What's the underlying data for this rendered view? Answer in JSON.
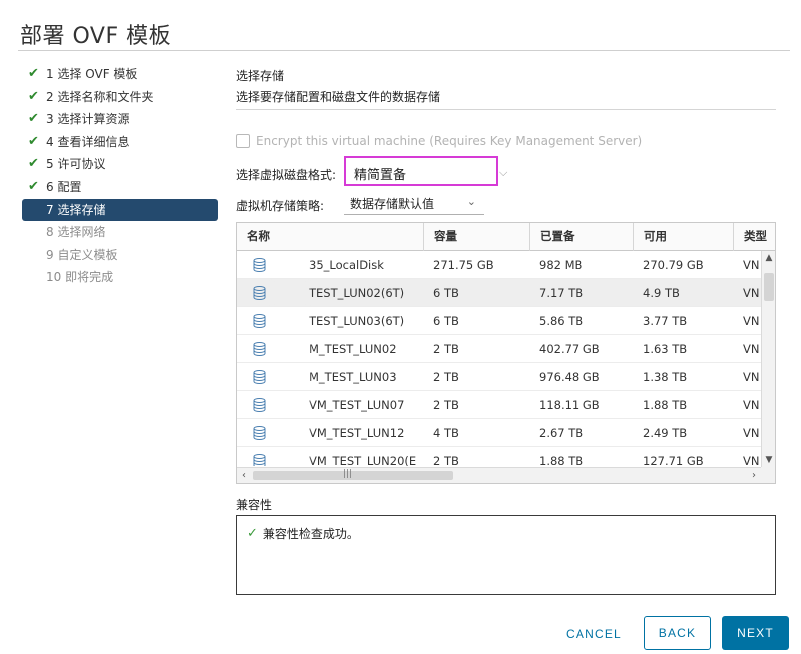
{
  "dialog": {
    "title": "部署 OVF 模板"
  },
  "steps": [
    {
      "label": "1 选择 OVF 模板",
      "state": "done"
    },
    {
      "label": "2 选择名称和文件夹",
      "state": "done"
    },
    {
      "label": "3 选择计算资源",
      "state": "done"
    },
    {
      "label": "4 查看详细信息",
      "state": "done"
    },
    {
      "label": "5 许可协议",
      "state": "done"
    },
    {
      "label": "6 配置",
      "state": "done"
    },
    {
      "label": "7 选择存储",
      "state": "active"
    },
    {
      "label": "8 选择网络",
      "state": "pending"
    },
    {
      "label": "9 自定义模板",
      "state": "pending"
    },
    {
      "label": "10 即将完成",
      "state": "pending"
    }
  ],
  "section": {
    "heading": "选择存储",
    "description": "选择要存储配置和磁盘文件的数据存储"
  },
  "encrypt": {
    "label": "Encrypt this virtual machine (Requires Key Management Server)",
    "checked": false,
    "disabled": true
  },
  "disk_format": {
    "label": "选择虚拟磁盘格式:",
    "value": "精简置备"
  },
  "storage_policy": {
    "label": "虚拟机存储策略:",
    "value": "数据存储默认值"
  },
  "table": {
    "columns": [
      "名称",
      "容量",
      "已置备",
      "可用",
      "类型"
    ],
    "rows": [
      {
        "name": "35_LocalDisk",
        "capacity": "271.75 GB",
        "provisioned": "982 MB",
        "free": "270.79 GB",
        "type": "VN",
        "selected": false
      },
      {
        "name": "TEST_LUN02(6T)",
        "capacity": "6 TB",
        "provisioned": "7.17 TB",
        "free": "4.9 TB",
        "type": "VN",
        "selected": true
      },
      {
        "name": "TEST_LUN03(6T)",
        "capacity": "6 TB",
        "provisioned": "5.86 TB",
        "free": "3.77 TB",
        "type": "VN",
        "selected": false
      },
      {
        "name": "M_TEST_LUN02",
        "capacity": "2 TB",
        "provisioned": "402.77 GB",
        "free": "1.63 TB",
        "type": "VN",
        "selected": false
      },
      {
        "name": "M_TEST_LUN03",
        "capacity": "2 TB",
        "provisioned": "976.48 GB",
        "free": "1.38 TB",
        "type": "VN",
        "selected": false
      },
      {
        "name": "VM_TEST_LUN07",
        "capacity": "2 TB",
        "provisioned": "118.11 GB",
        "free": "1.88 TB",
        "type": "VN",
        "selected": false
      },
      {
        "name": "VM_TEST_LUN12",
        "capacity": "4 TB",
        "provisioned": "2.67 TB",
        "free": "2.49 TB",
        "type": "VN",
        "selected": false
      },
      {
        "name": "VM_TEST_LUN20(E",
        "capacity": "2 TB",
        "provisioned": "1.88 TB",
        "free": "127.71 GB",
        "type": "VN",
        "selected": false
      }
    ]
  },
  "compatibility": {
    "label": "兼容性",
    "message": "兼容性检查成功。"
  },
  "buttons": {
    "cancel": "CANCEL",
    "back": "BACK",
    "next": "NEXT"
  },
  "colors": {
    "accent": "#0072a3",
    "active_step": "#244a6e",
    "highlight_border": "#d63ad6",
    "success": "#3b9a3b"
  }
}
